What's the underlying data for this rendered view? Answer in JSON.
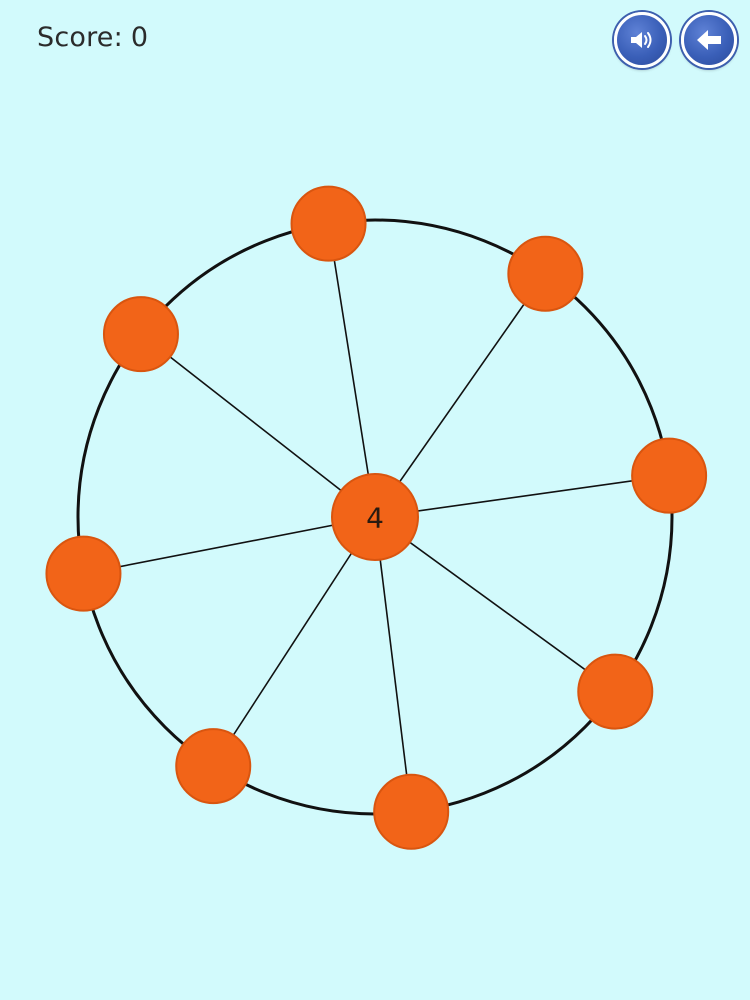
{
  "hud": {
    "score_label": "Score:",
    "score_value": "0",
    "sound_icon": "speaker-icon",
    "back_icon": "back-arrow-icon"
  },
  "board": {
    "hub_number": "4",
    "pin_count": 8,
    "pin_angles_deg": [
      -99,
      -55,
      -8,
      36,
      83,
      123,
      169,
      218
    ],
    "colors": {
      "background": "#d2fafc",
      "ball": "#f26418",
      "ball_edge": "#d9550f",
      "ring": "#111111",
      "button": "#3a5fb8"
    }
  }
}
